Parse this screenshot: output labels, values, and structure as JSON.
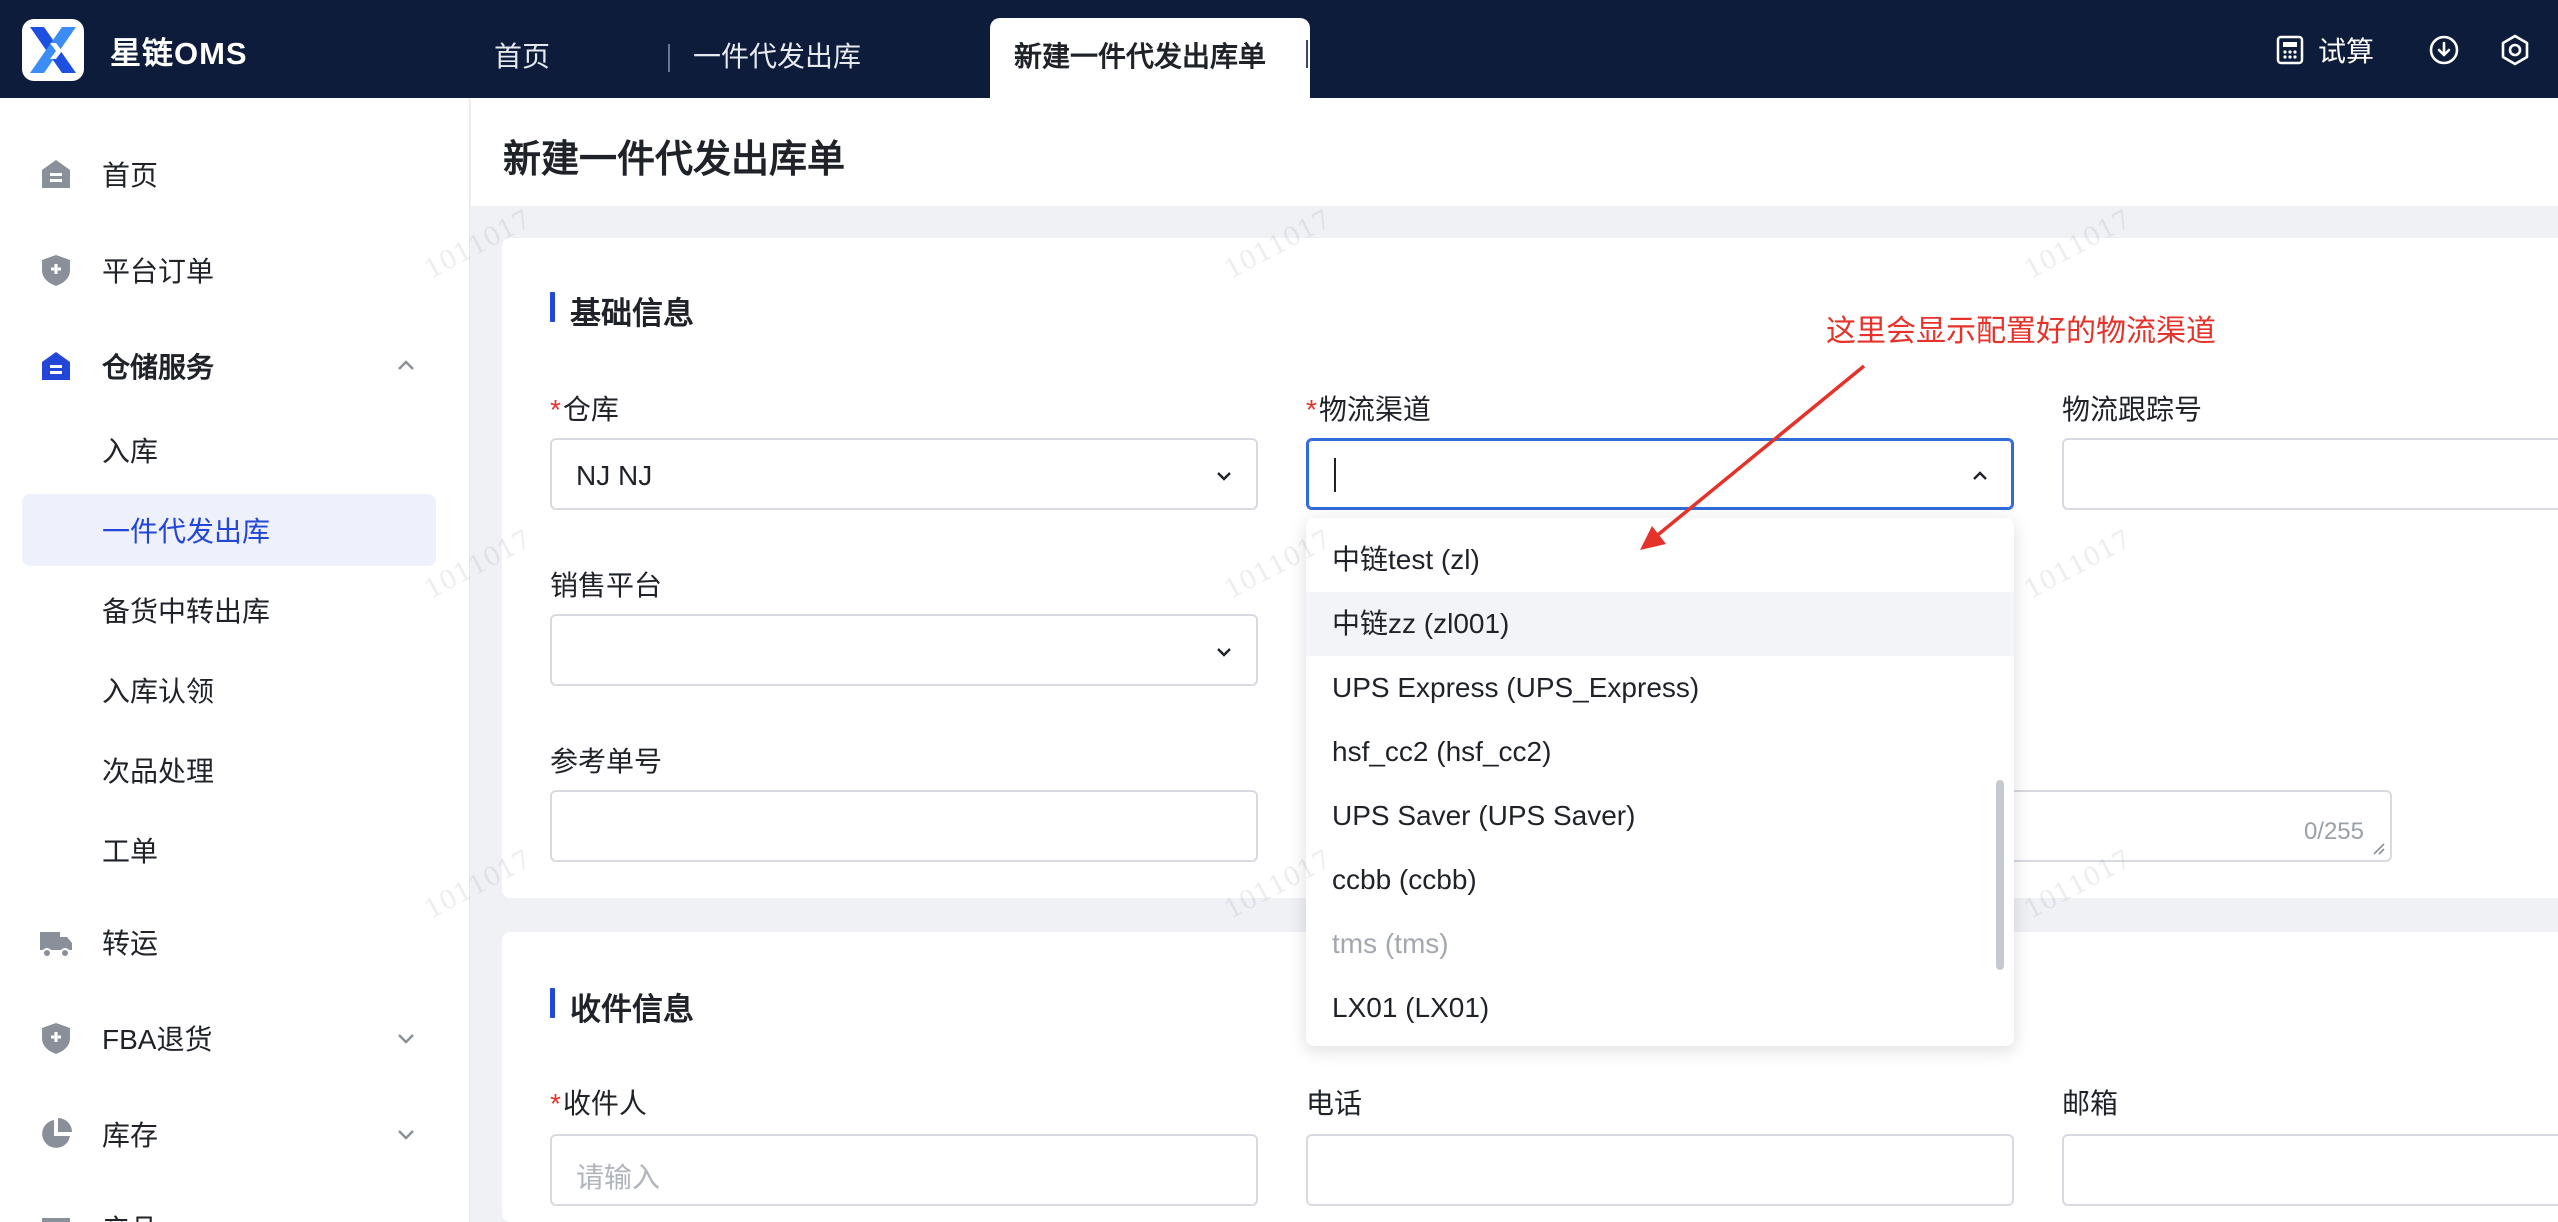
{
  "app": {
    "brand": "星链OMS"
  },
  "nav": {
    "tabs": [
      {
        "label": "首页"
      },
      {
        "label": "一件代发出库"
      },
      {
        "label": "新建一件代发出库单"
      }
    ],
    "trial_label": "试算"
  },
  "sidebar": {
    "items": [
      {
        "label": "首页",
        "icon": "home-icon"
      },
      {
        "label": "平台订单",
        "icon": "shield-icon"
      },
      {
        "label": "仓储服务",
        "icon": "warehouse-icon",
        "expanded": true
      },
      {
        "label": "转运",
        "icon": "truck-icon"
      },
      {
        "label": "FBA退货",
        "icon": "shield-icon"
      },
      {
        "label": "库存",
        "icon": "pie-chart-icon"
      }
    ],
    "sub_items": [
      {
        "label": "入库"
      },
      {
        "label": "一件代发出库",
        "active": true
      },
      {
        "label": "备货中转出库"
      },
      {
        "label": "入库认领"
      },
      {
        "label": "次品处理"
      },
      {
        "label": "工单"
      }
    ],
    "partial_item": "产品"
  },
  "page": {
    "title": "新建一件代发出库单"
  },
  "basic": {
    "title": "基础信息",
    "warehouse_label": "仓库",
    "warehouse_value": "NJ NJ",
    "channel_label": "物流渠道",
    "tracking_label": "物流跟踪号",
    "platform_label": "销售平台",
    "reference_label": "参考单号",
    "remark_counter": "0/255"
  },
  "recipient": {
    "title": "收件信息",
    "name_label": "收件人",
    "name_placeholder": "请输入",
    "phone_label": "电话",
    "email_label": "邮箱"
  },
  "dropdown": {
    "options": [
      {
        "label": "中链test (zl)",
        "state": "normal"
      },
      {
        "label": "中链zz (zl001)",
        "state": "hover"
      },
      {
        "label": "UPS Express (UPS_Express)",
        "state": "normal"
      },
      {
        "label": "hsf_cc2 (hsf_cc2)",
        "state": "normal"
      },
      {
        "label": "UPS Saver (UPS Saver)",
        "state": "normal"
      },
      {
        "label": "ccbb (ccbb)",
        "state": "normal"
      },
      {
        "label": "tms (tms)",
        "state": "disabled"
      },
      {
        "label": "LX01 (LX01)",
        "state": "normal"
      }
    ]
  },
  "annotation": {
    "text": "这里会显示配置好的物流渠道"
  },
  "colors": {
    "topbar": "#0d1c3a",
    "accent": "#2246d8",
    "required": "#e5322b",
    "annotation": "#e5322b"
  }
}
